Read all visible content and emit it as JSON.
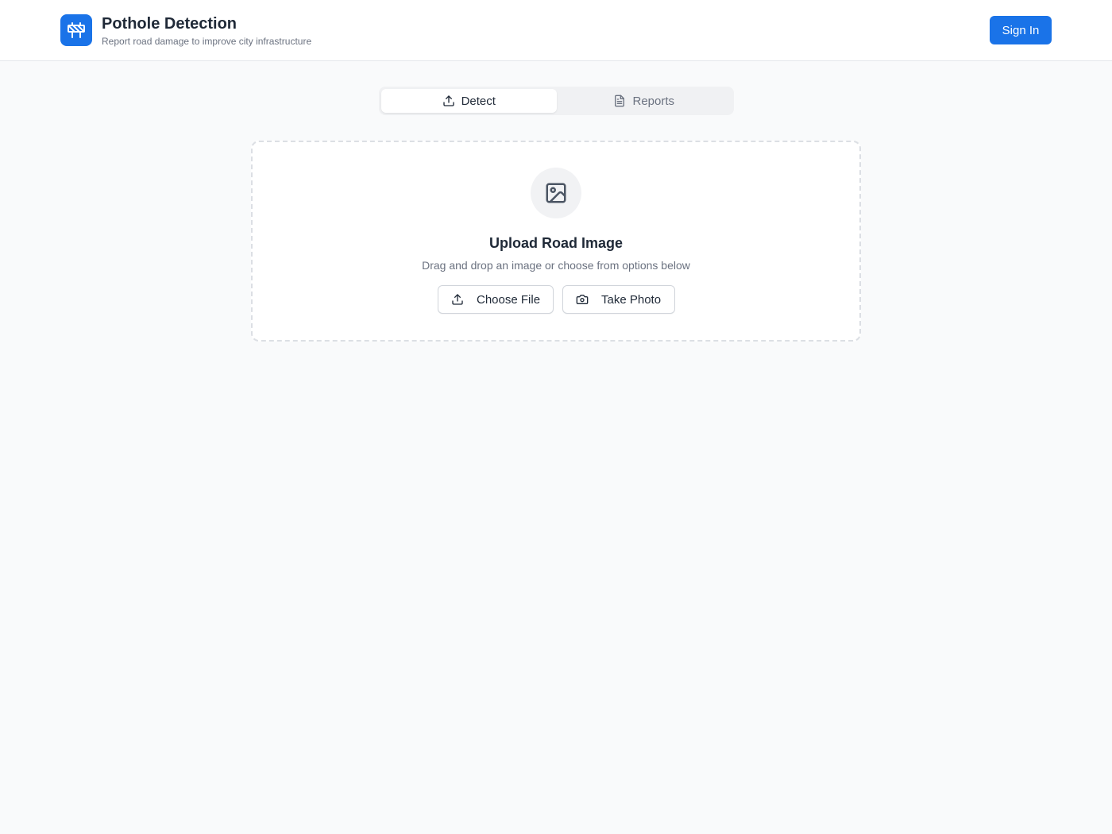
{
  "header": {
    "logo_icon": "road-barrier-icon",
    "title": "Pothole Detection",
    "subtitle": "Report road damage to improve city infrastructure",
    "signin_label": "Sign In"
  },
  "tabs": [
    {
      "label": "Detect",
      "icon": "upload-icon",
      "active": true
    },
    {
      "label": "Reports",
      "icon": "document-icon",
      "active": false
    }
  ],
  "upload": {
    "icon": "image-icon",
    "title": "Upload Road Image",
    "description": "Drag and drop an image or choose from options below",
    "choose_file_label": "Choose File",
    "take_photo_label": "Take Photo"
  },
  "colors": {
    "accent": "#1a73e8",
    "background": "#f9fafb"
  }
}
